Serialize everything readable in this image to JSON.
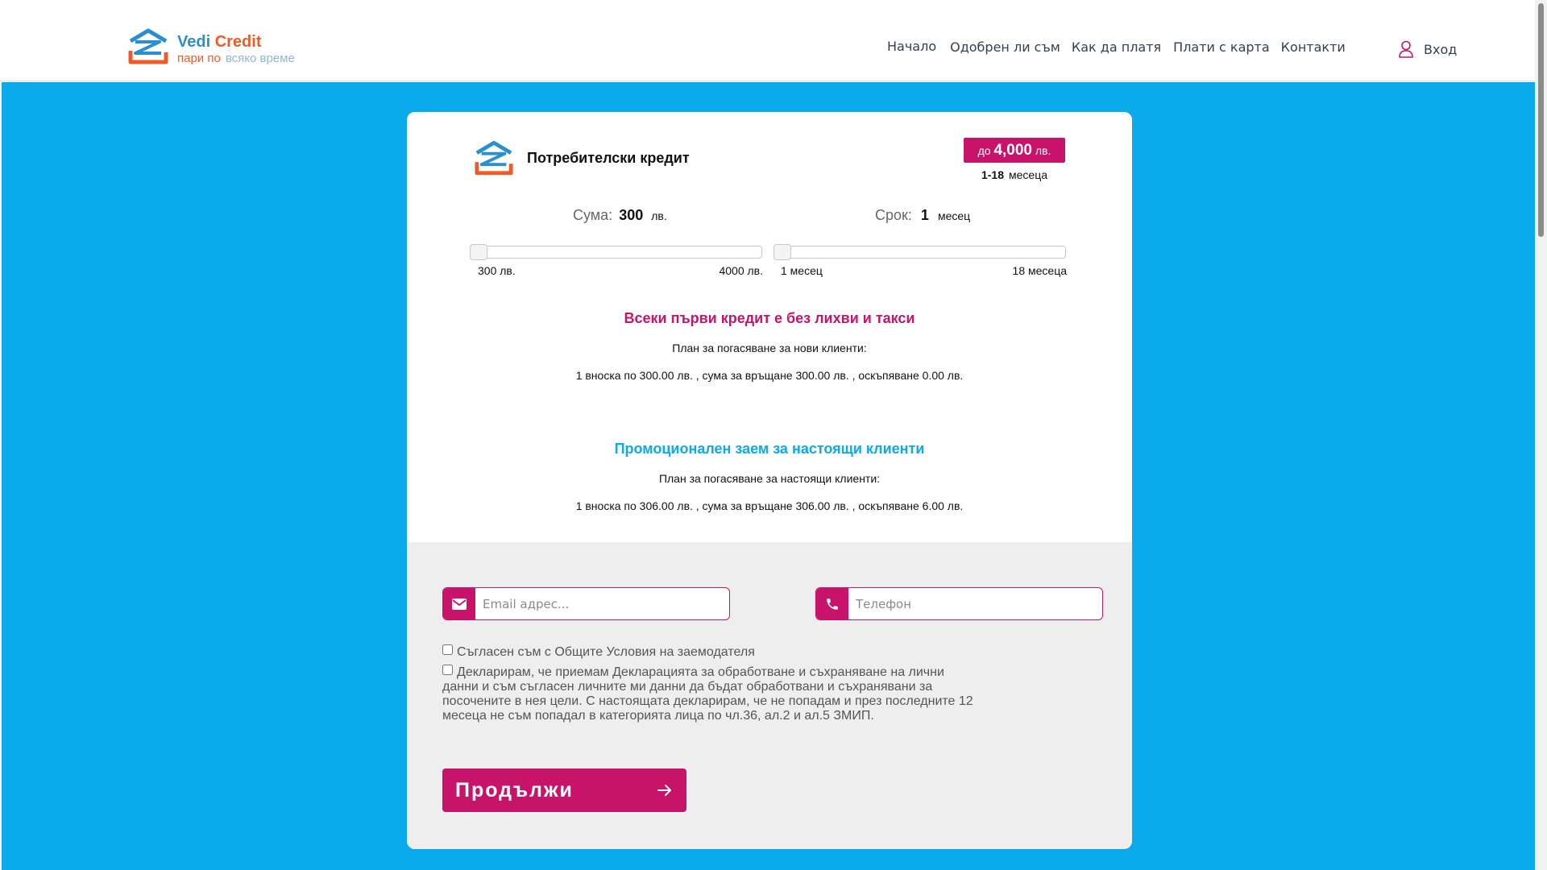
{
  "brand": {
    "title_part1": "Vedi",
    "title_part2": "Credit",
    "tagline_part1": "пари по",
    "tagline_part2": "всяко време",
    "colors": {
      "blue": "#2a8fd0",
      "orange": "#f05a28",
      "light_blue": "#8fb7d6"
    }
  },
  "nav": {
    "items": [
      {
        "label": "Начало"
      },
      {
        "label": "Одобрен ли съм"
      },
      {
        "label": "Как да платя"
      },
      {
        "label": "Плати с карта"
      },
      {
        "label": "Контакти"
      }
    ],
    "login_label": "Вход",
    "login_icon": "user-icon"
  },
  "product": {
    "title": "Потребителски кредит",
    "limit_prefix": "до",
    "limit_value": "4,000",
    "limit_unit": "лв.",
    "term_range": "1-18",
    "term_unit": "месеца"
  },
  "calculator": {
    "amount": {
      "label": "Сума:",
      "value": "300",
      "unit": "лв.",
      "min_label": "300 лв.",
      "max_label": "4000 лв.",
      "level": 0
    },
    "term": {
      "label": "Срок:",
      "value": "1",
      "unit": "месец",
      "min_label": "1 месец",
      "max_label": "18 месеца",
      "level": 0
    }
  },
  "offers": {
    "new": {
      "heading": "Всеки първи кредит е без лихви и такси",
      "plan_title": "План за погасяване за нови клиенти:",
      "plan_text": "1 вноска по 300.00 лв. , сума за връщане 300.00 лв. , оскъпяване 0.00 лв."
    },
    "existing": {
      "heading": "Промоционален заем за настоящи клиенти",
      "plan_title": "План за погасяване за настоящи клиенти:",
      "plan_text": "1 вноска по 306.00 лв. , сума за връщане 306.00 лв. , оскъпяване 6.00 лв."
    }
  },
  "form": {
    "email": {
      "placeholder": "Email адрес...",
      "value": "",
      "icon": "mail-icon"
    },
    "phone": {
      "placeholder": "Телефон",
      "value": "",
      "icon": "phone-icon"
    },
    "terms_label": "Съгласен съм с Общите Условия на заемодателя",
    "terms_checked": false,
    "declaration_label": "Декларирам, че приемам Декларацията за обработване и съхраняване на лични данни и съм съгласен личните ми данни да бъдат обработвани и съхранявани за посочените в нея цели. С настоящата декларирам, че не попадам и през последните 12 месеца не съм попадал в категорията лица по чл.36, ал.2 и ал.5 ЗМИП.",
    "declaration_checked": false,
    "submit_label": "Продължи",
    "submit_icon": "arrow-right-icon"
  },
  "colors": {
    "accent": "#c8136a",
    "background_blue": "#0baaeb",
    "form_bg": "#eeeeee"
  }
}
